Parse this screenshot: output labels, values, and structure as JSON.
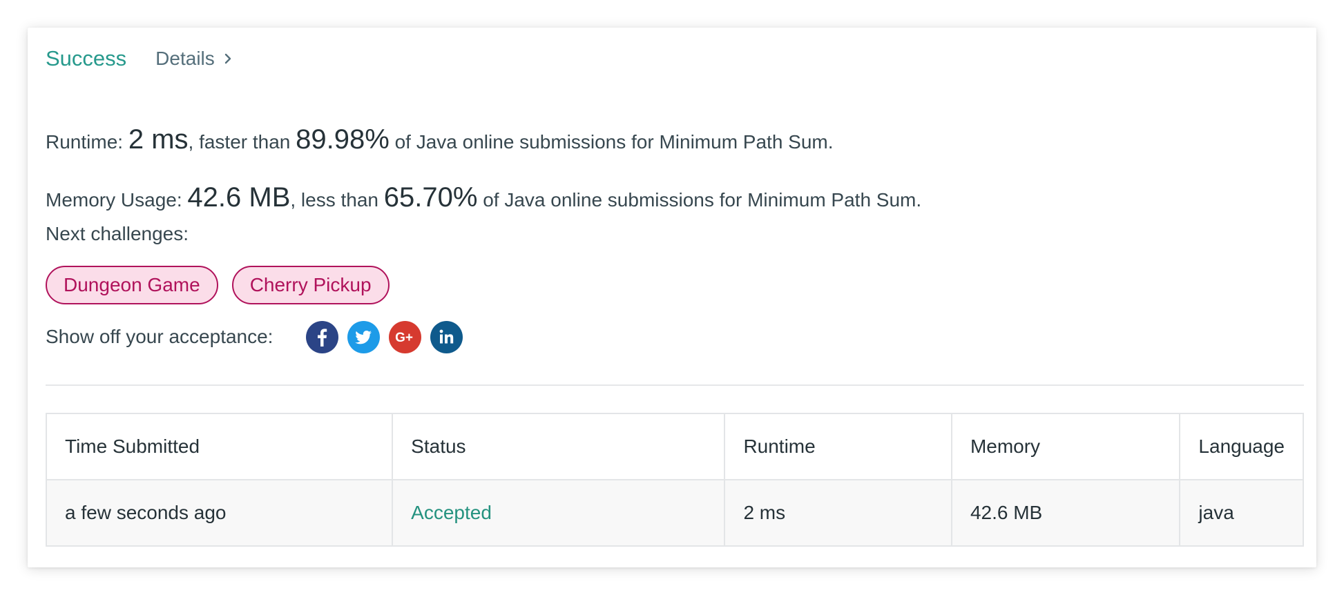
{
  "header": {
    "status": "Success",
    "details_label": "Details"
  },
  "runtime": {
    "prefix": "Runtime: ",
    "value": "2 ms",
    "middle": ", faster than ",
    "percent": "89.98%",
    "suffix": " of Java online submissions for Minimum Path Sum."
  },
  "memory": {
    "prefix": "Memory Usage: ",
    "value": "42.6 MB",
    "middle": ", less than ",
    "percent": "65.70%",
    "suffix": " of Java online submissions for Minimum Path Sum."
  },
  "next_challenges": {
    "label": "Next challenges:",
    "items": [
      "Dungeon Game",
      "Cherry Pickup"
    ]
  },
  "share": {
    "label": "Show off your acceptance:",
    "icons": [
      {
        "name": "facebook-icon",
        "color": "#2b4486"
      },
      {
        "name": "twitter-icon",
        "color": "#1d9be8"
      },
      {
        "name": "google-plus-icon",
        "color": "#d63a2f"
      },
      {
        "name": "linkedin-icon",
        "color": "#0f5a8c"
      }
    ]
  },
  "table": {
    "headers": [
      "Time Submitted",
      "Status",
      "Runtime",
      "Memory",
      "Language"
    ],
    "rows": [
      [
        "a few seconds ago",
        "Accepted",
        "2 ms",
        "42.6 MB",
        "java"
      ]
    ]
  },
  "colors": {
    "success": "#26998c",
    "accepted": "#24927f",
    "tag_border": "#b0125b",
    "tag_bg": "#fbdde9"
  }
}
